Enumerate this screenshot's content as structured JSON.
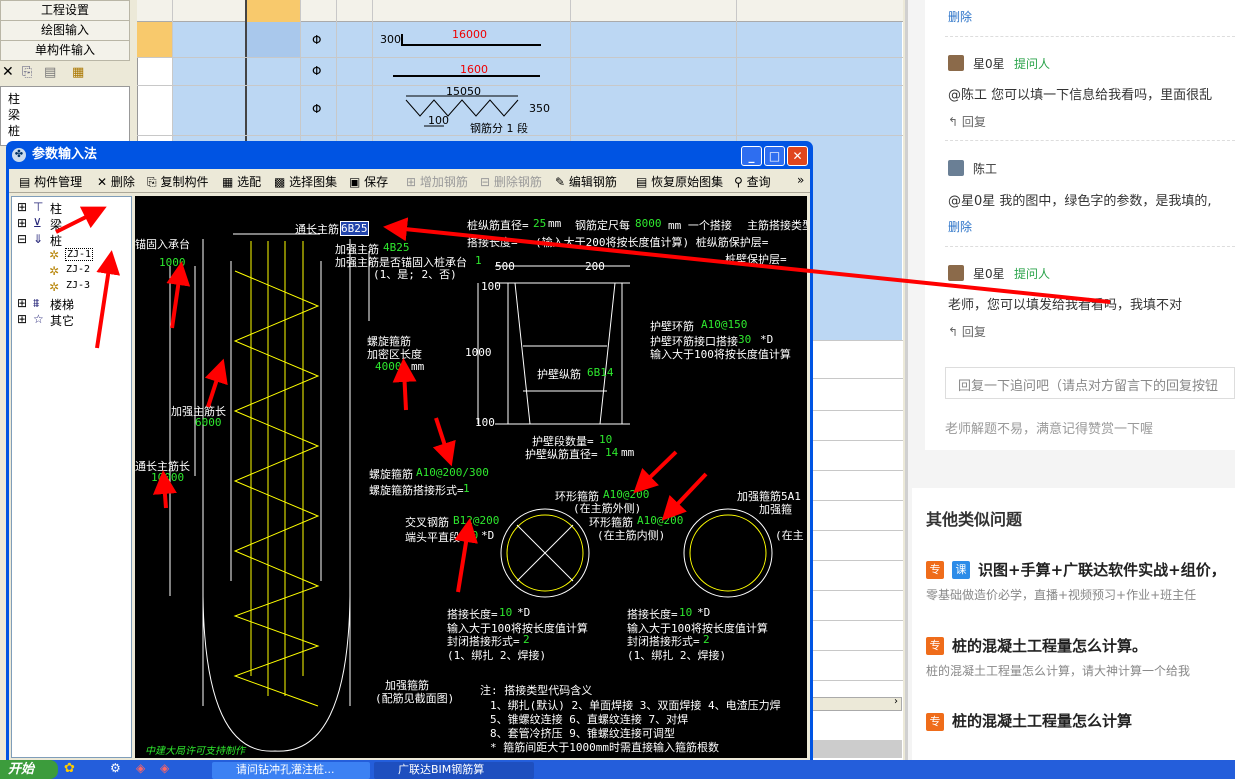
{
  "left_menu": {
    "item1": "工程设置",
    "item2": "绘图输入",
    "item3": "单构件输入"
  },
  "left_tree": [
    "柱",
    "梁",
    "桩"
  ],
  "grid": {
    "row1": {
      "mark": "Φ",
      "length_left": "300",
      "length_top": "16000"
    },
    "row2": {
      "mark": "Φ",
      "length_top": "1600"
    },
    "row3": {
      "mark": "Φ",
      "length_top": "15050",
      "height": "350",
      "pitch": "100",
      "note": "钢筋分 1 段"
    }
  },
  "right_panel": {
    "delete1": "删除",
    "c1": {
      "user": "星0星",
      "role": "提问人",
      "text": "@陈工  您可以填一下信息给我看吗，里面很乱",
      "reply": "回复"
    },
    "c2": {
      "user": "陈工",
      "text": "@星0星  我的图中，绿色字的参数，是我填的,",
      "delete": "删除"
    },
    "c3": {
      "user": "星0星",
      "role": "提问人",
      "text": "老师，您可以填发给我看看吗，我填不对",
      "reply": "回复"
    },
    "input_placeholder": "回复一下追问吧（请点对方留言下的回复按钮",
    "tip": "老师解题不易，满意记得赞赏一下喔"
  },
  "other": {
    "title": "其他类似问题",
    "q1": {
      "tag1": "专",
      "tag2": "课",
      "title": "识图+手算+广联达软件实战+组价，",
      "desc": "零基础做造价必学，直播+视频预习+作业+班主任"
    },
    "q2": {
      "tag": "专",
      "title": "桩的混凝土工程量怎么计算。",
      "desc": "桩的混凝土工程量怎么计算，请大神计算一个给我"
    },
    "q3": {
      "tag": "专",
      "title": "桩的混凝土工程量怎么计算"
    }
  },
  "dialog": {
    "title": "参数输入法",
    "toolbar": [
      "构件管理",
      "删除",
      "复制构件",
      "选配",
      "选择图集",
      "保存",
      "增加钢筋",
      "删除钢筋",
      "编辑钢筋",
      "恢复原始图集",
      "查询"
    ],
    "toolbar_more": "»",
    "tree": [
      "柱",
      "梁",
      "桩",
      "ZJ-1",
      "ZJ-2",
      "ZJ-3",
      "楼梯",
      "其它"
    ]
  },
  "drawing": {
    "t_tongchang": "通长主筋",
    "v_tongchang": "6B25",
    "t_zhuijing": "桩纵筋直径=",
    "v_zhuijing": "25",
    "t_dingchi": "钢筋定尺每",
    "v_dingchi": "8000",
    "t_dingchi2": "mm 一个搭接",
    "t_zhujin_type": "主筋搭接类型",
    "t_dajie": "搭接长度=",
    "t_dajie_note": "(输入大于200将按长度值计算)  桩纵筋保护层=",
    "t_baohu2": "桩壁保护层=",
    "t_chengtai": "锚固入承台",
    "v_chengtai": "1000",
    "t_jiaqiang": "加强主筋",
    "v_jiaqiang": "4B25",
    "t_maogu": "加强主筋是否锚固入桩承台",
    "v_maogu": "1",
    "t_maogu2": "(1、是; 2、否)",
    "t_luoxuan": "螺旋箍筋",
    "t_jiami": "加密区长度",
    "v_jiami": "4000",
    "t_mm": "mm",
    "t_jqcz": "加强主筋长",
    "v_jqcz": "6000",
    "t_tczc": "通长主筋长",
    "v_tczc": "10000",
    "v_500": "500",
    "v_200": "200",
    "v_100a": "100",
    "v_1000": "1000",
    "v_100b": "100",
    "t_hubihuan": "护壁环筋",
    "v_hubihuan": "A10@150",
    "t_hubidajie": "护壁环筋接口搭接",
    "v_hubidajie": "30",
    "t_d": "*D",
    "t_hubinote": "输入大于100将按长度值计算",
    "t_hubizong": "护壁纵筋",
    "v_hubizong": "6B14",
    "t_hubiduan": "护壁段数量=",
    "v_hubiduan": "10",
    "t_hubizj": "护壁纵筋直径=",
    "v_hubizj": "14",
    "t_lxgj": "螺旋箍筋",
    "v_lxgj": "A10@200/300",
    "t_lxdj": "螺旋箍筋搭接形式=",
    "v_lxdj": "1",
    "t_huanx1": "环形箍筋",
    "v_huanx1": "A10@200",
    "t_zwai": "(在主筋外侧)",
    "t_huanx2": "环形箍筋",
    "v_huanx2": "A10@200",
    "t_znei": "(在主筋内侧)",
    "t_jqgj": "加强箍筋5A1",
    "t_jqgj2": "加强箍",
    "t_zai": "(在主",
    "t_jiaocha": "交叉钢筋",
    "v_jiaocha": "B12@200",
    "t_duantou": "端头平直段",
    "v_duantou": "10",
    "t_dj1": "搭接长度=",
    "v_dj1": "10",
    "t_dj_note": "输入大于100将按长度值计算",
    "t_fengbi": "封闭搭接形式=",
    "v_fengbi": "2",
    "t_bangza": "(1、绑扎  2、焊接)",
    "t_dj2": "搭接长度=",
    "v_dj2": "10",
    "t_jqgj_bottom": "加强箍筋",
    "t_peijian": "(配筋见截面图)",
    "notes": [
      "注: 搭接类型代码含义",
      "1、绑扎(默认)   2、单面焊接   3、双面焊接   4、电渣压力焊",
      "5、锥螺纹连接   6、直螺纹连接   7、对焊",
      "8、套管冷挤压   9、锥螺纹连接可调型",
      "* 箍筋间距大于1000mm时需直接输入箍筋根数"
    ],
    "watermark": "中建大局许可支持制作"
  },
  "taskbar": {
    "start": "开始",
    "task1": "请问钻冲孔灌注桩...",
    "task2": "广联达BIM钢筋算"
  }
}
